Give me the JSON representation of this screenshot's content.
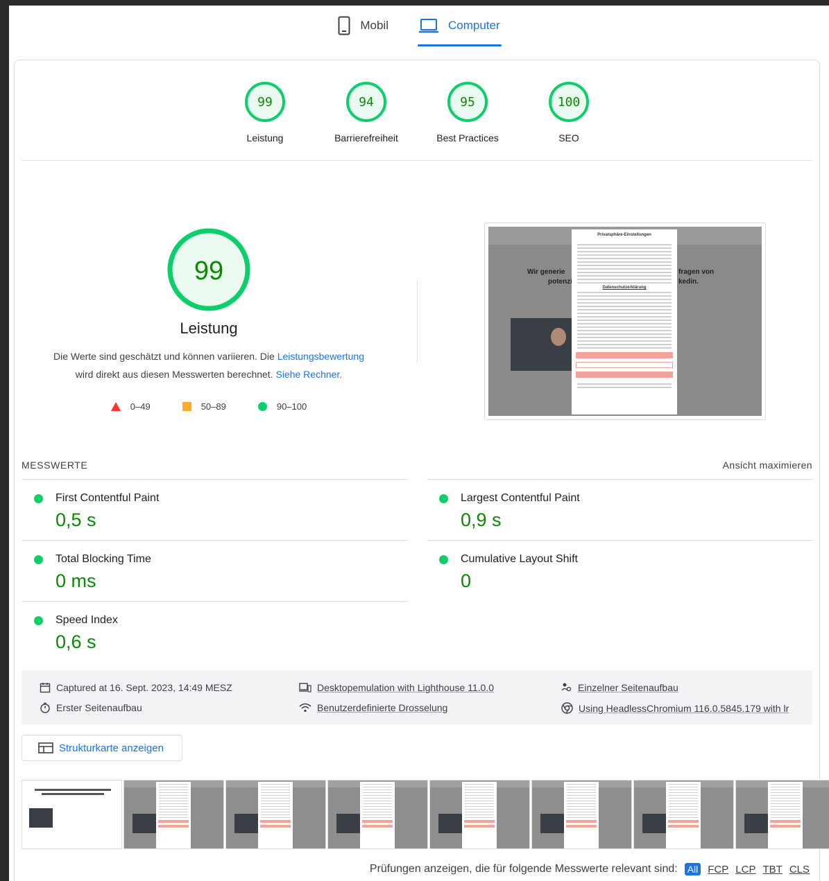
{
  "tabs": [
    {
      "label": "Mobil",
      "icon": "smartphone-icon",
      "active": false
    },
    {
      "label": "Computer",
      "icon": "laptop-icon",
      "active": true
    }
  ],
  "categories": [
    {
      "score": "99",
      "label": "Leistung"
    },
    {
      "score": "94",
      "label": "Barrierefreiheit"
    },
    {
      "score": "95",
      "label": "Best Practices"
    },
    {
      "score": "100",
      "label": "SEO"
    }
  ],
  "performance": {
    "score": "99",
    "title": "Leistung",
    "desc_before": "Die Werte sind geschätzt und können variieren. Die ",
    "desc_link": "Leistungsbewertung",
    "desc_middle": "wird direkt aus diesen Messwerten berechnet. ",
    "desc_link2": "Siehe Rechner.",
    "legend": [
      {
        "range": "0–49",
        "color": "#ff3333",
        "shape": "triangle"
      },
      {
        "range": "50–89",
        "color": "#ffaa33",
        "shape": "square"
      },
      {
        "range": "90–100",
        "color": "#0cce6b",
        "shape": "circle"
      }
    ]
  },
  "colors": {
    "pass": "#0cce6b",
    "pass_text": "#0b8a00",
    "gauge_fill": "#eafaf1",
    "accent": "#1a73e8"
  },
  "metrics": {
    "title": "MESSWERTE",
    "toggle": "Ansicht maximieren",
    "items": [
      {
        "name": "First Contentful Paint",
        "value": "0,5 s"
      },
      {
        "name": "Largest Contentful Paint",
        "value": "0,9 s"
      },
      {
        "name": "Total Blocking Time",
        "value": "0 ms"
      },
      {
        "name": "Cumulative Layout Shift",
        "value": "0"
      },
      {
        "name": "Speed Index",
        "value": "0,6 s"
      }
    ]
  },
  "environment": {
    "captured": "Captured at 16. Sept. 2023, 14:49 MESZ",
    "emulation": "Desktopemulation with Lighthouse 11.0.0",
    "single_load": "Einzelner Seitenaufbau",
    "initial_load": "Erster Seitenaufbau",
    "throttling": "Benutzerdefinierte Drosselung",
    "browser": "Using HeadlessChromium 116.0.5845.179 with lr"
  },
  "treemap_button": "Strukturkarte anzeigen",
  "filter": {
    "label": "Prüfungen anzeigen, die für folgende Messwerte relevant sind:",
    "chips": [
      "All",
      "FCP",
      "LCP",
      "TBT",
      "CLS"
    ]
  },
  "screenshot": {
    "modal_title": "Privatsphäre-Einstellungen",
    "modal_heading": "Datenschutzerklärung",
    "headline_left": "Wir generie",
    "headline_left2": "potenzie",
    "headline_right": "fragen von",
    "headline_right2": "kedin."
  }
}
